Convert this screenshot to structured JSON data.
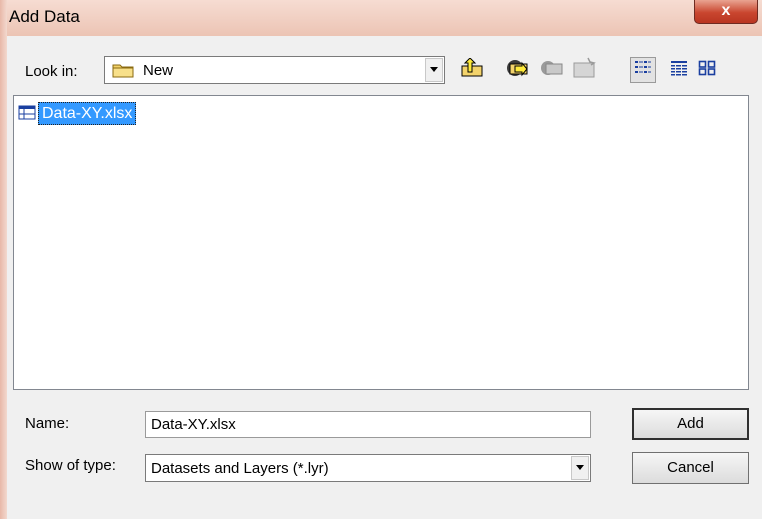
{
  "window": {
    "title": "Add Data",
    "close_label": "x"
  },
  "toolbar": {
    "look_in_label": "Look in:",
    "look_in_value": "New",
    "buttons": [
      {
        "name": "up-one-level",
        "icon": "up-arrow-folder-icon"
      },
      {
        "name": "connect-to-folder",
        "icon": "connect-folder-icon"
      },
      {
        "name": "disconnect-folder",
        "icon": "disconnect-folder-icon"
      },
      {
        "name": "new-folder",
        "icon": "new-folder-icon"
      },
      {
        "name": "list-view",
        "icon": "list-view-icon"
      },
      {
        "name": "details-view",
        "icon": "details-view-icon"
      },
      {
        "name": "thumbnails-view",
        "icon": "thumbnails-view-icon"
      }
    ]
  },
  "files": [
    {
      "name": "Data-XY.xlsx",
      "icon": "table-icon",
      "selected": true
    }
  ],
  "name_field": {
    "label": "Name:",
    "value": "Data-XY.xlsx"
  },
  "type_field": {
    "label": "Show of type:",
    "value": "Datasets and Layers (*.lyr)"
  },
  "buttons": {
    "add": "Add",
    "cancel": "Cancel"
  },
  "colors": {
    "selection": "#3399ff",
    "title_bar": "#f6dcd2",
    "close": "#c9462f"
  }
}
